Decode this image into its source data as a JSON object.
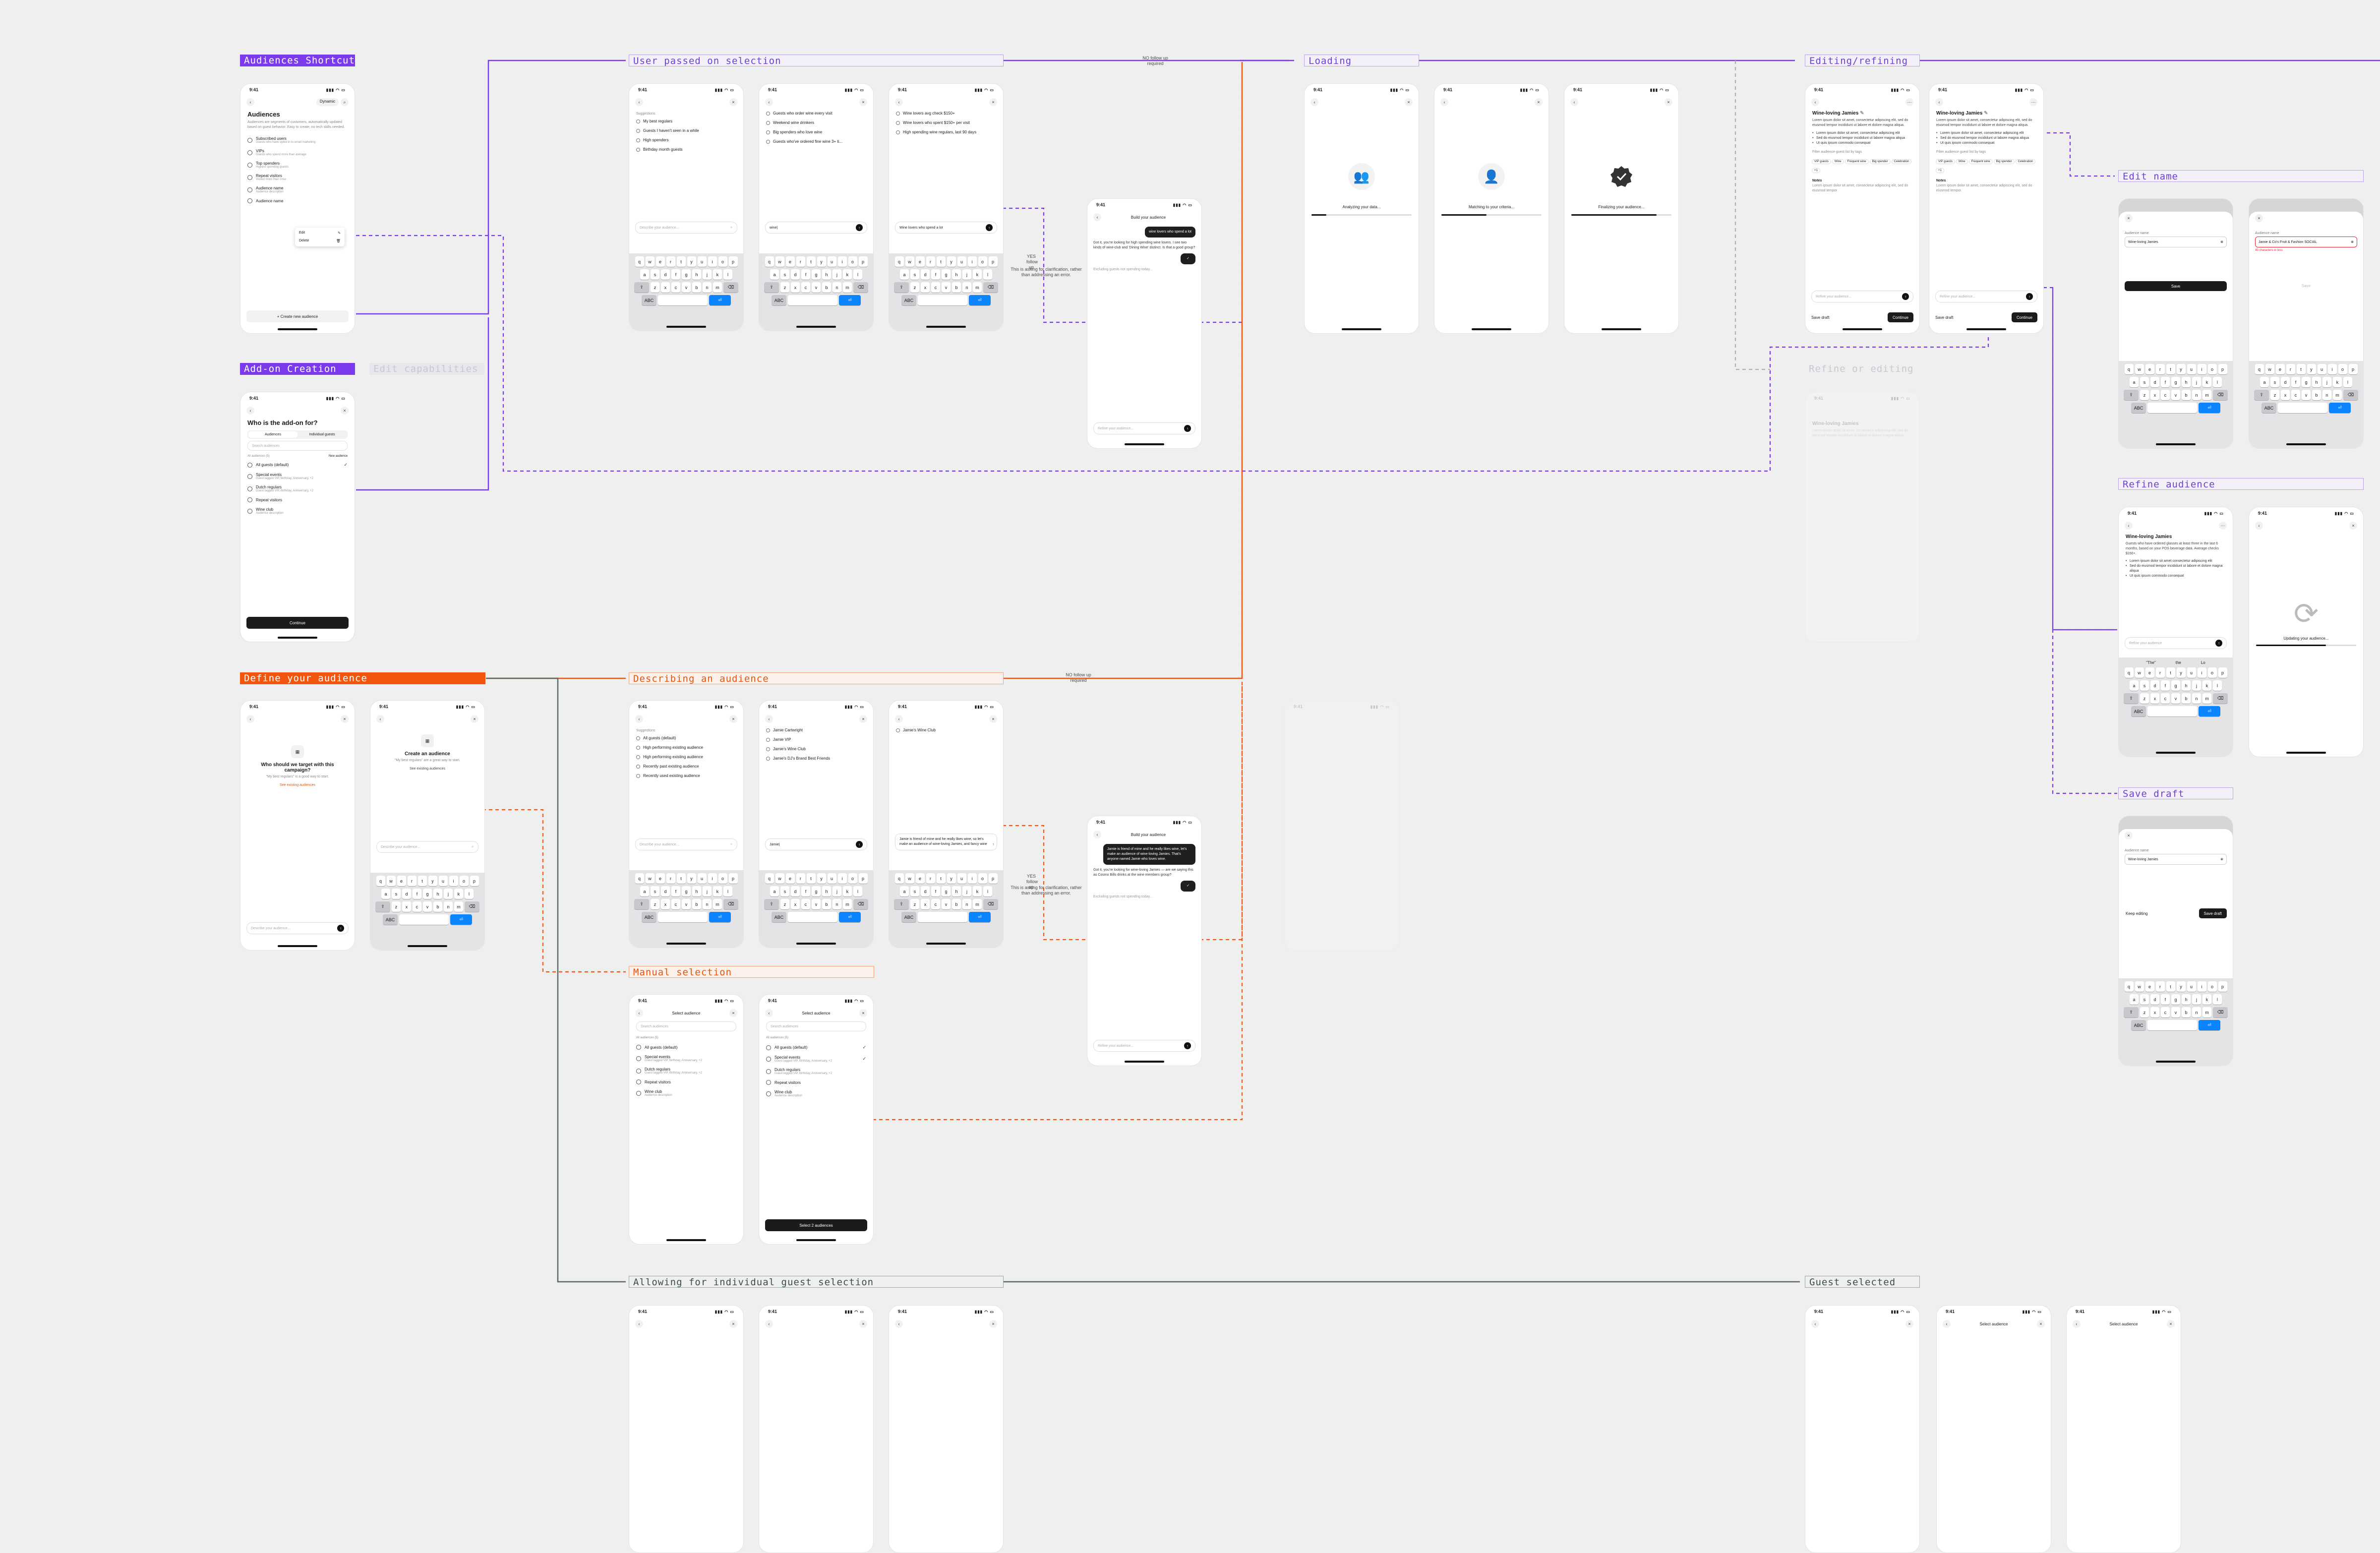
{
  "colors": {
    "canvas": "#efefef",
    "purple": "#7c3aed",
    "orange": "#f2550d",
    "gray": "#4d5a54",
    "key_blue": "#0a84ff"
  },
  "sections": {
    "audiences_shortcut": "Audiences Shortcut",
    "addon_creation": "Add-on Creation",
    "addon_ghost": "Edit capabilities",
    "define_audience": "Define your audience",
    "user_passed": "User passed on selection",
    "loading": "Loading",
    "editing": "Editing/refining",
    "edit_name": "Edit name",
    "refine_audience": "Refine audience",
    "save_draft": "Save draft",
    "describing": "Describing an audience",
    "manual": "Manual selection",
    "allowing": "Allowing for individual guest selection",
    "guest_selected": "Guest selected",
    "ghost_editing": "Refine or editing"
  },
  "notes": {
    "no_followup": "NO follow up required",
    "yes_followup": "YES follow up",
    "clarify": "This is asking for clarification, rather than addressing an error."
  },
  "status": {
    "time": "9:41",
    "signal": "▮▮▮ ◠ ▭"
  },
  "keyboard": {
    "row1": [
      "q",
      "w",
      "e",
      "r",
      "t",
      "y",
      "u",
      "i",
      "o",
      "p"
    ],
    "row2": [
      "a",
      "s",
      "d",
      "f",
      "g",
      "h",
      "j",
      "k",
      "l"
    ],
    "row3": [
      "z",
      "x",
      "c",
      "v",
      "b",
      "n",
      "m"
    ],
    "abc": "ABC",
    "ret": "⏎"
  },
  "audiences": {
    "title": "Audiences",
    "desc": "Audiences are segments of customers, automatically updated based on guest behavior. Easy to create, no tech skills needed.",
    "pill": "Dynamic",
    "items": [
      {
        "name": "Subscribed users",
        "sub": "Guests who have opted in to email marketing"
      },
      {
        "name": "VIPs",
        "sub": "Guests who spend more than average"
      },
      {
        "name": "Top spenders",
        "sub": "Highest spending guests"
      },
      {
        "name": "Repeat visitors",
        "sub": "Visited more than once"
      },
      {
        "name": "Audience name",
        "sub": "Audience description"
      },
      {
        "name": "Audience name",
        "sub": ""
      }
    ],
    "menu": [
      "Edit",
      "Delete"
    ],
    "create": "+ Create new audience"
  },
  "addon": {
    "title": "Who is the add-on for?",
    "seg": [
      "Audiences",
      "Individual guests"
    ],
    "search": "Search audiences",
    "count": "All audiences (5)",
    "new": "New audience",
    "items": [
      {
        "name": "All guests (default)",
        "sub": ""
      },
      {
        "name": "Special events",
        "sub": "Guest tagged VIP, Birthday, Anniversary, +2"
      },
      {
        "name": "Dutch regulars",
        "sub": "Guest tagged VIP, Birthday, Anniversary, +2"
      },
      {
        "name": "Repeat visitors",
        "sub": ""
      },
      {
        "name": "Wine club",
        "sub": "Audience description"
      }
    ],
    "continue": "Continue"
  },
  "passed": {
    "s1": {
      "label": "Suggestions",
      "items": [
        "My best regulars",
        "Guests I haven't seen in a while",
        "High spenders",
        "Birthday month guests"
      ],
      "ask": "Describe your audience..."
    },
    "s2": {
      "items": [
        "Guests who order wine every visit",
        "Weekend wine drinkers",
        "Big spenders who love wine",
        "Guests who've ordered fine wine 3+ ti..."
      ],
      "ask": "wine|"
    },
    "s3": {
      "items": [
        "Wine lovers avg check $150+",
        "Wine lovers who spent $150+ per visit",
        "High spending wine regulars, last 90 days"
      ],
      "ask": "Wine lovers who spend a lot"
    },
    "chat": {
      "title": "Build your audience",
      "user": "wine lovers who spend a lot",
      "bot": "Got it, you're looking for high spending wine lovers. I see two kinds of wine-club and 'Dining Wine' distinct. Is that a good group?",
      "action": "Excluding guests not spending today...",
      "ask": "Refine your audience..."
    }
  },
  "loading": {
    "steps": [
      {
        "label": "Analyzing your data...",
        "icon": "👥",
        "prog": 15
      },
      {
        "label": "Matching to your criteria...",
        "icon": "👤",
        "prog": 45
      },
      {
        "label": "Finalizing your audience...",
        "icon": "✔",
        "prog": 85
      }
    ]
  },
  "editing": {
    "name": "Wine-loving Jamies",
    "desc": "Lorem ipsum dolor sit amet, consectetur adipiscing elit, sed do eiusmod tempor incididunt ut labore et dolore magna aliqua.",
    "bullets": [
      "Lorem ipsum dolor sit amet, consectetur adipiscing elit",
      "Sed do eiusmod tempor incididunt ut labore magna aliqua",
      "Ut quis ipsum commodo consequat"
    ],
    "filters_label": "Filter audience guest list by tags",
    "chips": [
      "VIP guests",
      "Wine",
      "Frequent wine",
      "Big spender",
      "Celebration",
      "+1"
    ],
    "notes_label": "Notes",
    "notes": "Lorem ipsum dolor sit amet, consectetur adipiscing elit, sed do eiusmod tempor.",
    "ask": "Refine your audience...",
    "save_draft": "Save draft",
    "continue": "Continue"
  },
  "editname": {
    "label": "Audience name",
    "value": "Wine-loving Jamies",
    "value_long": "Jamie & Co's Fruit & Fashion SOCIAL",
    "err": "40 characters or less",
    "save": "Save"
  },
  "refine": {
    "name": "Wine-loving Jamies",
    "desc": "Guests who have ordered glasses at least three in the last 6 months, based on your POS beverage data. Average checks $150+.",
    "bullets": [
      "Lorem ipsum dolor sit amet consectetur adipiscing elit",
      "Sed do eiusmod tempor incididunt ut labore et dolore magna aliqua",
      "Ut quis ipsum commodo consequat"
    ],
    "ask": "Refine your audience",
    "suggest": [
      "\"The\"",
      "the",
      "Lo"
    ],
    "updating": "Updating your audience..."
  },
  "savedraft": {
    "label": "Audience name",
    "value": "Wine-loving Jamies",
    "keep": "Keep editing",
    "save": "Save draft"
  },
  "define": {
    "q1": "Who should we target with this campaign?",
    "q1sub": "\"My best regulars\" is a good way to start.",
    "link": "See existing audiences",
    "q2": "Create an audience",
    "q2sub": "\"My best regulars\" are a great way to start.",
    "link2": "See existing audiences",
    "ask": "Describe your audience..."
  },
  "describing": {
    "s1": {
      "label": "Suggestions",
      "items": [
        "All guests (default)",
        "High performing existing audience",
        "High performing existing audience",
        "Recently past existing audience",
        "Recently used existing audience"
      ],
      "ask": "Describe your audience..."
    },
    "s2": {
      "items": [
        "Jamie Cartwright",
        "Jamie VIP",
        "Jamie's Wine Club",
        "Jamie's DJ's Brand Best Friends"
      ],
      "ask": "Jamie|"
    },
    "s3": {
      "item": "Jamie's Wine Club",
      "typed": "Jamie is friend of mine and he really likes wine, so let's make an audience of wine-loving Jamies, and fancy wine"
    },
    "chat": {
      "title": "Build your audience",
      "user": "Jamie is friend of mine and he really likes wine, let's make an audience of wine-loving Jamies. That's anyone named Jamie who loves wine.",
      "bot": "Got it, you're looking for wine-loving Jamies — are we saying this as Cosmo Bills drinks at the wine members group?",
      "action": "Excluding guests not spending today...",
      "ask": "Refine your audience..."
    }
  },
  "manual": {
    "title": "Select audience",
    "search": "Search audiences",
    "count": "All audiences (5)",
    "items": [
      {
        "name": "All guests (default)",
        "sub": ""
      },
      {
        "name": "Special events",
        "sub": "Guest tagged VIP, Birthday, Anniversary, +2"
      },
      {
        "name": "Dutch regulars",
        "sub": "Guest tagged VIP, Birthday, Anniversary, +2"
      },
      {
        "name": "Repeat visitors",
        "sub": ""
      },
      {
        "name": "Wine club",
        "sub": "Audience description"
      }
    ],
    "select": "Select 2 audiences"
  }
}
